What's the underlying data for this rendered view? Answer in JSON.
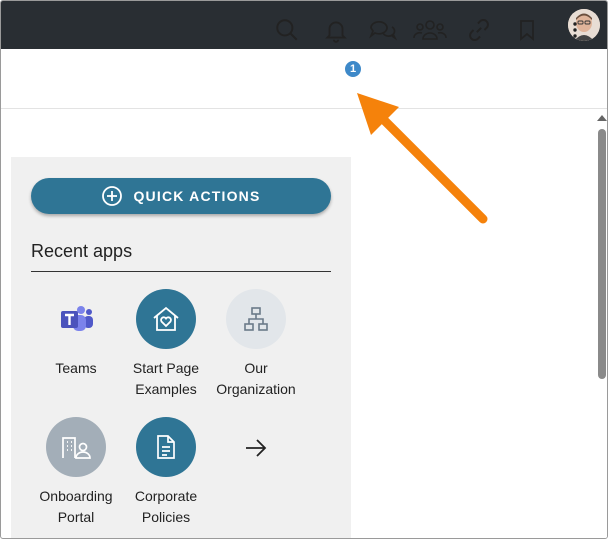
{
  "header": {
    "avatar_icon": "user-avatar"
  },
  "toolbar": {
    "icons": [
      "search-icon",
      "bell-icon",
      "chat-icon",
      "people-icon",
      "link-icon",
      "bookmark-icon",
      "more-vertical-icon"
    ],
    "notification_count": "1"
  },
  "panel": {
    "quick_actions_label": "QUICK ACTIONS",
    "recent_apps_title": "Recent apps",
    "apps": [
      {
        "label": "Teams",
        "icon": "teams-icon"
      },
      {
        "label": "Start Page\nExamples",
        "icon": "home-heart-icon"
      },
      {
        "label": "Our\nOrganization",
        "icon": "org-chart-icon"
      },
      {
        "label": "Onboarding\nPortal",
        "icon": "building-person-icon"
      },
      {
        "label": "Corporate\nPolicies",
        "icon": "document-icon"
      }
    ],
    "more_icon": "arrow-right-icon"
  },
  "colors": {
    "topbar": "#292e33",
    "accent": "#2f7595",
    "badge": "#3e89c9",
    "callout_arrow": "#f5820b"
  }
}
